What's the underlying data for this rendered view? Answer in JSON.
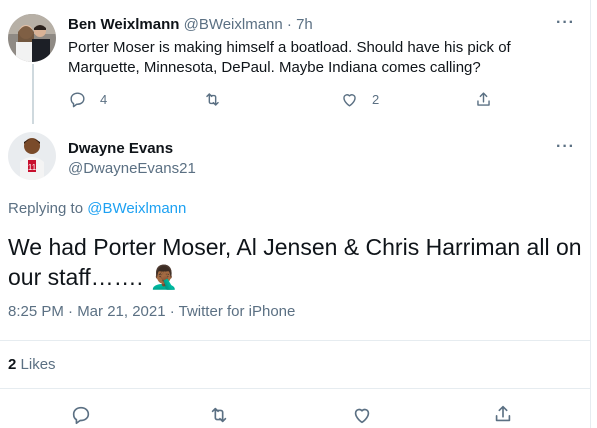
{
  "parent_tweet": {
    "name": "Ben Weixlmann",
    "handle": "@BWeixlmann",
    "separator": "·",
    "time": "7h",
    "text_line1": "Porter Moser is making himself a boatload. Should have his pick of",
    "text_line2": "Marquette, Minnesota, DePaul. Maybe Indiana comes calling?",
    "reply_count": "4",
    "like_count": "2",
    "more": "···"
  },
  "main_tweet": {
    "name": "Dwayne Evans",
    "handle": "@DwayneEvans21",
    "more": "···",
    "replying_prefix": "Replying to",
    "replying_to": "@BWeixlmann",
    "text_line1": "We had Porter Moser, Al Jensen & Chris Harriman all on",
    "text_line2": "our staff……. ",
    "emoji": "🤦🏾‍♂️",
    "timestamp": "8:25 PM · Mar 21, 2021 · Twitter for iPhone",
    "likes_count": "2",
    "likes_label": "Likes"
  },
  "icons": {
    "reply": "reply-icon",
    "retweet": "retweet-icon",
    "like": "heart-icon",
    "share": "share-icon"
  },
  "colors": {
    "accent": "#1da1f2",
    "muted": "#5b7083",
    "text": "#0f1419",
    "border": "#e6ecf0"
  }
}
